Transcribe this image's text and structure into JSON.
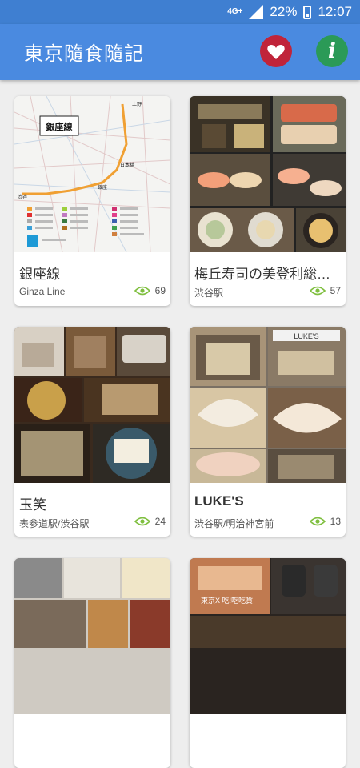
{
  "status_bar": {
    "network": "4G+",
    "battery": "22%",
    "time": "12:07"
  },
  "app_bar": {
    "title": "東京隨食隨記",
    "info_glyph": "i",
    "colors": {
      "bar": "#4a8ae0",
      "favorite": "#c0243a",
      "info": "#2b9a57"
    }
  },
  "cards": [
    {
      "title": "銀座線",
      "subtitle": "Ginza Line",
      "views": "69",
      "map_label": "銀座線",
      "stations": [
        "上野",
        "日本橋",
        "銀座",
        "渋谷"
      ]
    },
    {
      "title": "梅丘寿司の美登利総本店",
      "subtitle": "渋谷駅",
      "views": "57"
    },
    {
      "title": "玉笑",
      "subtitle": "表参道駅/渋谷駅",
      "views": "24"
    },
    {
      "title": "LUKE'S",
      "subtitle": "渋谷駅/明治神宮前",
      "views": "13",
      "sign_text": "LUKE'S"
    },
    {
      "title": "",
      "subtitle": "",
      "views": ""
    },
    {
      "title": "",
      "subtitle": "",
      "views": "",
      "overlay_text": "東京X 吃!吃吃貨"
    }
  ]
}
